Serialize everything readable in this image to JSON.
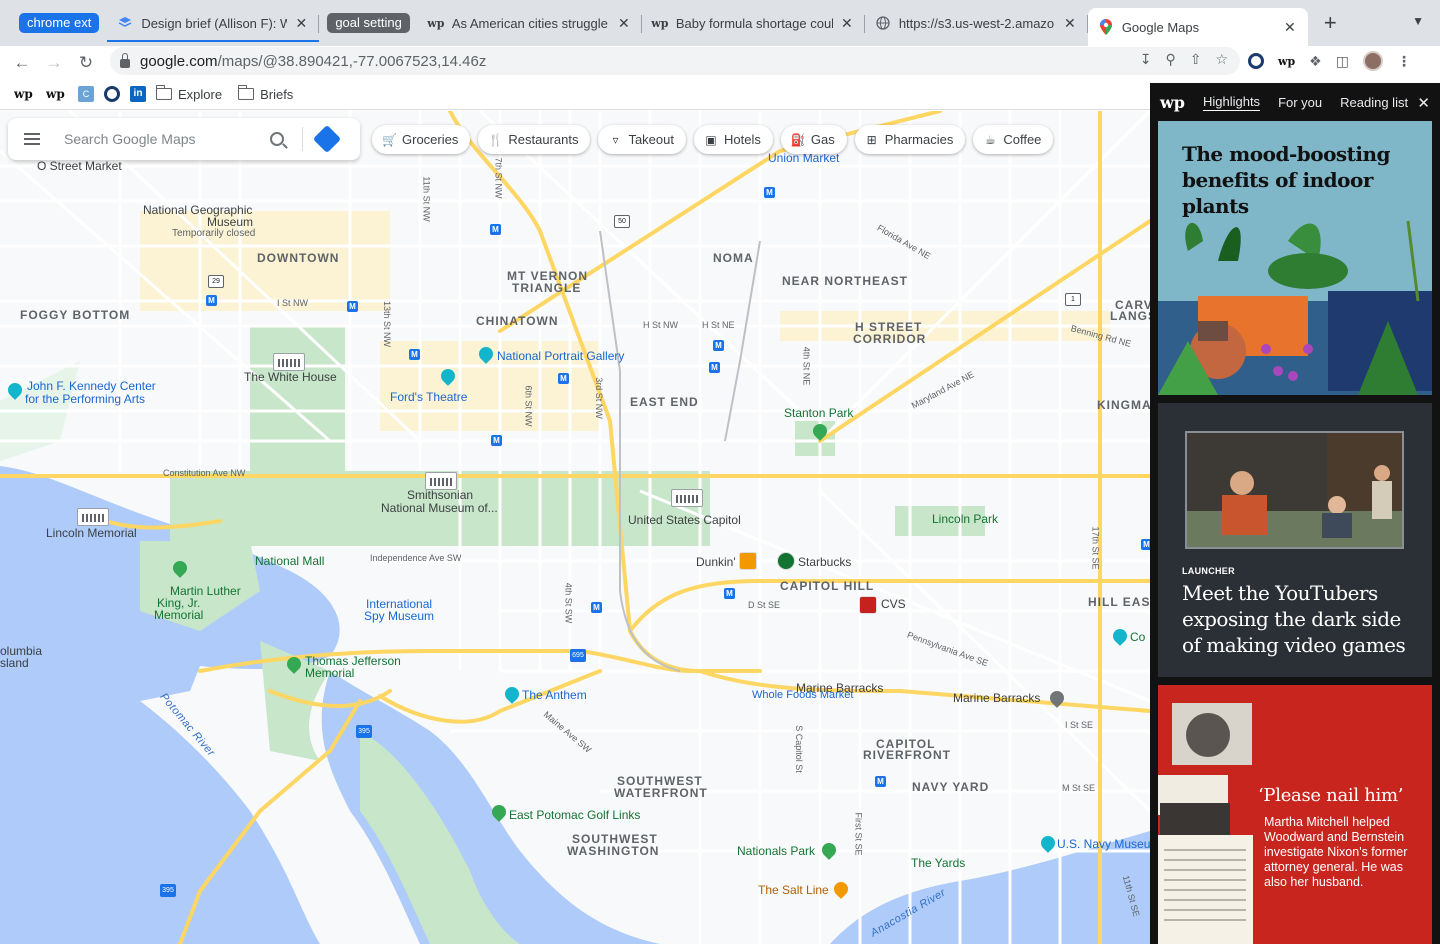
{
  "tabs": {
    "group1_label": "chrome ext",
    "group2_label": "goal setting",
    "items": [
      {
        "title": "Design brief (Allison F): Was",
        "favicon": "stack-icon"
      },
      {
        "title": "As American cities struggle",
        "favicon": "wp"
      },
      {
        "title": "Baby formula shortage coulc",
        "favicon": "wp"
      },
      {
        "title": "https://s3.us-west-2.amazo",
        "favicon": "globe-icon"
      },
      {
        "title": "Google Maps",
        "favicon": "maps-pin-icon"
      }
    ],
    "new_tab": "+",
    "close": "✕"
  },
  "toolbar": {
    "url_host": "google.com",
    "url_path": "/maps/@38.890421,-77.0067523,14.46z"
  },
  "bookmarks": {
    "wp1": "wp",
    "wp2": "wp",
    "box_label": "C",
    "linkedin": "in",
    "folder1": "Explore",
    "folder2": "Briefs"
  },
  "map": {
    "search_placeholder": "Search Google Maps",
    "chips": [
      "Groceries",
      "Restaurants",
      "Takeout",
      "Hotels",
      "Gas",
      "Pharmacies",
      "Coffee"
    ],
    "neighborhoods": [
      "DOWNTOWN",
      "FOGGY BOTTOM",
      "MT VERNON",
      "TRIANGLE",
      "CHINATOWN",
      "NOMA",
      "NEAR NORTHEAST",
      "H STREET",
      "CORRIDOR",
      "EAST END",
      "CAPITOL HILL",
      "HILL EAST",
      "SOUTHWEST",
      "WATERFRONT",
      "CAPITOL",
      "RIVERFRONT",
      "NAVY YARD",
      "SOUTHWEST",
      "WASHINGTON",
      "KINGMAN",
      "CARV",
      "LANGS"
    ],
    "pois": [
      "National Geographic",
      "Museum",
      "Temporarily closed",
      "The White House",
      "John F. Kennedy Center",
      "for the Performing Arts",
      "National Portrait Gallery",
      "Ford's Theatre",
      "Smithsonian",
      "National Museum of...",
      "United States Capitol",
      "Lincoln Memorial",
      "National Mall",
      "Martin Luther",
      "King, Jr.",
      "Memorial",
      "International",
      "Spy Museum",
      "Thomas Jefferson",
      "Memorial",
      "The Anthem",
      "Stanton Park",
      "Lincoln Park",
      "Dunkin'",
      "Starbucks",
      "CVS",
      "Marine Barracks",
      "Whole Foods Market",
      "Union Market",
      "East Potomac Golf Links",
      "Nationals Park",
      "The Yards",
      "The Salt Line",
      "U.S. Navy Museu",
      "O Street Market",
      "Co",
      "olumbia",
      "sland"
    ],
    "streets": [
      "Constitution Ave NW",
      "Independence Ave SW",
      "I St NW",
      "H St NW",
      "H St NE",
      "D St SE",
      "Florida Ave NE",
      "Maryland Ave NE",
      "Benning Rd NE",
      "Pennsylvania Ave SE",
      "Maine Ave SW",
      "M St SE",
      "I St SE",
      "11th St NW",
      "7th St NW",
      "13th St NW",
      "6th St NW",
      "3rd St NW",
      "4th St NE",
      "4th St SW",
      "S Capitol St",
      "First St SE",
      "17th St SE",
      "11th St SE"
    ],
    "water": [
      "Potomac River",
      "Anacostia River"
    ],
    "shields": [
      "50",
      "29",
      "1",
      "695",
      "395",
      "395"
    ]
  },
  "sidepanel": {
    "logo": "wp",
    "tabs": [
      "Highlights",
      "For you",
      "Reading list"
    ],
    "close": "✕",
    "card1_title": "The mood-boosting benefits of indoor plants",
    "card2_kicker": "LAUNCHER",
    "card2_title": "Meet the YouTubers exposing the dark side of making video games",
    "card3_title": "‘Please nail him’",
    "card3_body": "Martha Mitchell helped Woodward and Bernstein investigate Nixon's former attorney general. He was also her husband."
  },
  "colors": {
    "accent_blue": "#1a73e8",
    "map_water": "#aecbfa",
    "map_park": "#c8e6c9",
    "map_highway": "#fdd663",
    "wp_red": "#c8251f"
  }
}
